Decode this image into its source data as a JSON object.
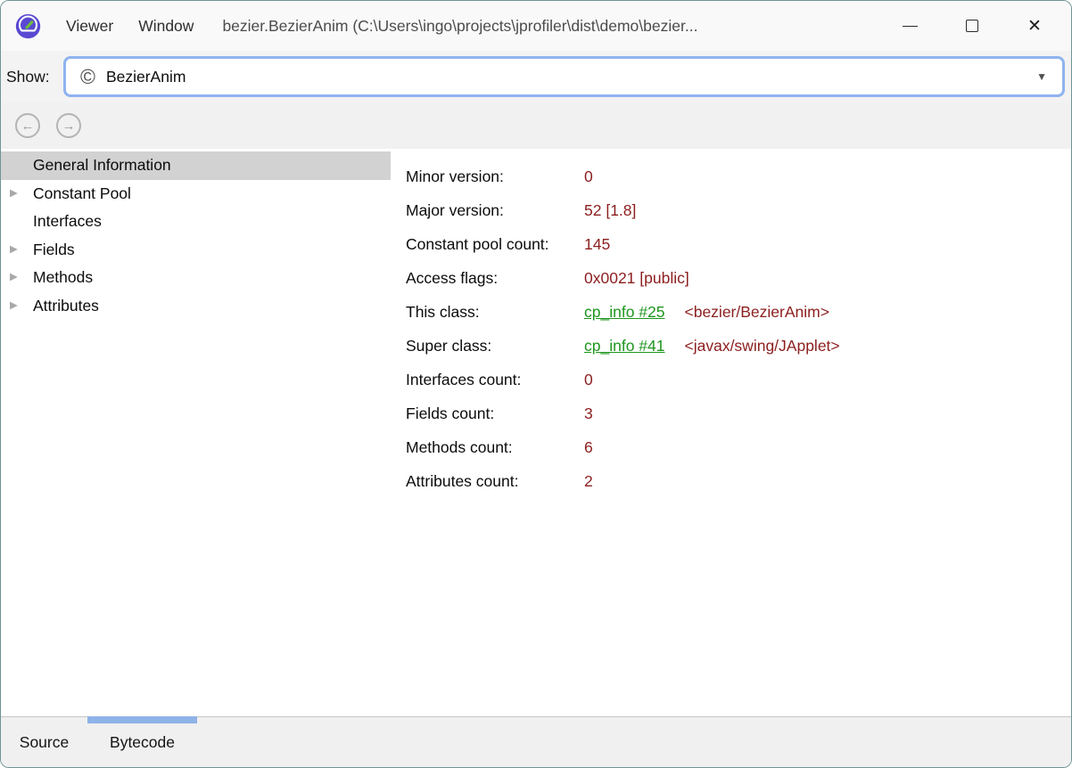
{
  "window": {
    "title": "bezier.BezierAnim (C:\\Users\\ingo\\projects\\jprofiler\\dist\\demo\\bezier...",
    "menus": [
      {
        "label": "Viewer"
      },
      {
        "label": "Window"
      }
    ]
  },
  "icons": {
    "app": "jprofiler-gauge-icon",
    "class_glyph": "©",
    "dropdown_glyph": "▼",
    "back_glyph": "←",
    "forward_glyph": "→",
    "close_glyph": "✕"
  },
  "toolbar": {
    "show_label": "Show:",
    "combo_value": "BezierAnim"
  },
  "tree": {
    "items": [
      {
        "label": "General Information",
        "expander": "",
        "selected": true
      },
      {
        "label": "Constant Pool",
        "expander": "▶",
        "selected": false
      },
      {
        "label": "Interfaces",
        "expander": "",
        "selected": false
      },
      {
        "label": "Fields",
        "expander": "▶",
        "selected": false
      },
      {
        "label": "Methods",
        "expander": "▶",
        "selected": false
      },
      {
        "label": "Attributes",
        "expander": "▶",
        "selected": false
      }
    ]
  },
  "details": {
    "rows": [
      {
        "label": "Minor version:",
        "value": "0"
      },
      {
        "label": "Major version:",
        "value": "52 [1.8]"
      },
      {
        "label": "Constant pool count:",
        "value": "145"
      },
      {
        "label": "Access flags:",
        "value": "0x0021 [public]"
      },
      {
        "label": "This class:",
        "link": "cp_info #25",
        "value": "<bezier/BezierAnim>"
      },
      {
        "label": "Super class:",
        "link": "cp_info #41",
        "value": "<javax/swing/JApplet>"
      },
      {
        "label": "Interfaces count:",
        "value": "0"
      },
      {
        "label": "Fields count:",
        "value": "3"
      },
      {
        "label": "Methods count:",
        "value": "6"
      },
      {
        "label": "Attributes count:",
        "value": "2"
      }
    ]
  },
  "tabs": [
    {
      "label": "Source",
      "active": false
    },
    {
      "label": "Bytecode",
      "active": true
    }
  ],
  "colors": {
    "value_red": "#8c1e1e",
    "link_green": "#1e961e",
    "focus_border_blue": "#8fb3ef",
    "tab_indicator_blue": "#8fb2e8",
    "selection_gray": "#d2d2d2",
    "window_border_teal": "#6f9494"
  }
}
